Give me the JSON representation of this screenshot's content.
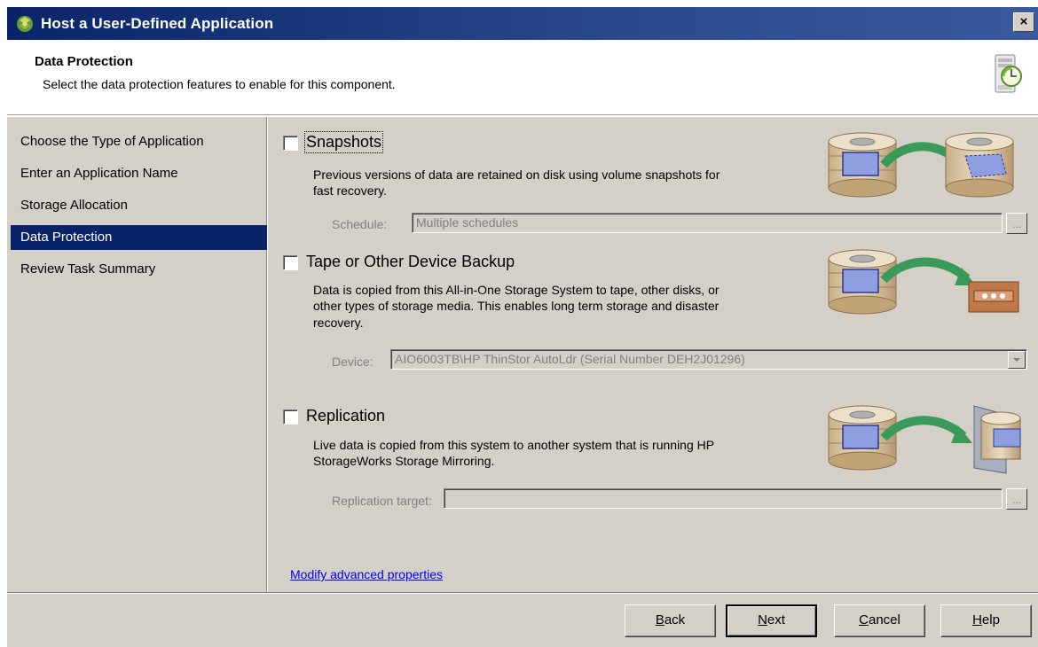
{
  "window": {
    "title": "Host a User-Defined Application",
    "close_label": "×",
    "icon": "app-icon"
  },
  "header": {
    "title": "Data Protection",
    "subtitle": "Select the data protection features to enable for this component.",
    "icon": "clock-server-icon"
  },
  "nav": {
    "items": [
      {
        "label": "Choose the Type of Application",
        "selected": false
      },
      {
        "label": "Enter an Application Name",
        "selected": false
      },
      {
        "label": "Storage Allocation",
        "selected": false
      },
      {
        "label": "Data Protection",
        "selected": true
      },
      {
        "label": "Review Task Summary",
        "selected": false
      }
    ]
  },
  "options": {
    "snapshots": {
      "label": "Snapshots",
      "checked": false,
      "desc1": "Previous versions of data are retained on disk using volume snapshots for",
      "desc2": "fast recovery.",
      "field_label": "Schedule:",
      "field_value": "Multiple schedules",
      "button_label": "..."
    },
    "tape": {
      "label": "Tape or Other Device Backup",
      "checked": false,
      "desc1": "Data is copied from this All-in-One Storage System to tape, other disks, or",
      "desc2": "other types of storage media.  This enables long term storage and disaster",
      "desc3": "recovery.",
      "field_label": "Device:",
      "field_value": "AIO6003TB\\HP ThinStor AutoLdr (Serial Number DEH2J01296)"
    },
    "replication": {
      "label": "Replication",
      "checked": false,
      "desc1": "Live data is copied from this system to another system that is running HP",
      "desc2": "StorageWorks Storage Mirroring.",
      "field_label": "Replication target:",
      "field_value": "",
      "button_label": "..."
    }
  },
  "advanced_link": "Modify advanced properties",
  "buttons": {
    "back_key": "B",
    "back_rest": "ack",
    "next_key": "N",
    "next_rest": "ext",
    "cancel_key": "C",
    "cancel_rest": "ancel",
    "help_key": "H",
    "help_rest": "elp"
  },
  "colors": {
    "titlebar": "#0a246a",
    "selection": "#0a246a",
    "dialog_face": "#d4d0c8",
    "link": "#0000ff"
  }
}
